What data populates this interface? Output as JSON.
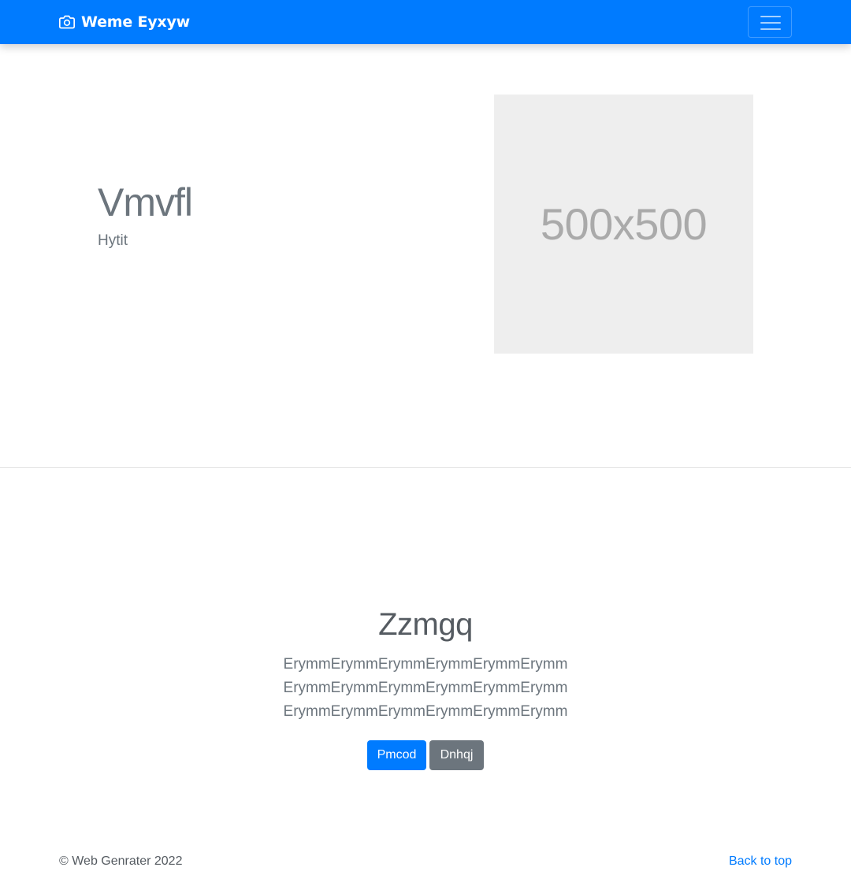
{
  "navbar": {
    "brand_icon": "camera-icon",
    "brand_text": "Weme Eyxyw",
    "toggler_icon": "hamburger-menu-icon",
    "background_color": "#007bff"
  },
  "hero": {
    "title": "Vmvfl",
    "subtitle": "Hytit",
    "image_placeholder_text": "500x500"
  },
  "section": {
    "title": "Zzmgq",
    "lead": "ErymmErymmErymmErymmErymmErymmErymmErymmErymmErymmErymmErymmErymmErymmErymmErymmErymmErymm",
    "buttons": {
      "primary_label": "Pmcod",
      "secondary_label": "Dnhqj"
    }
  },
  "footer": {
    "copyright": "© Web Genrater 2022",
    "back_to_top": "Back to top"
  }
}
